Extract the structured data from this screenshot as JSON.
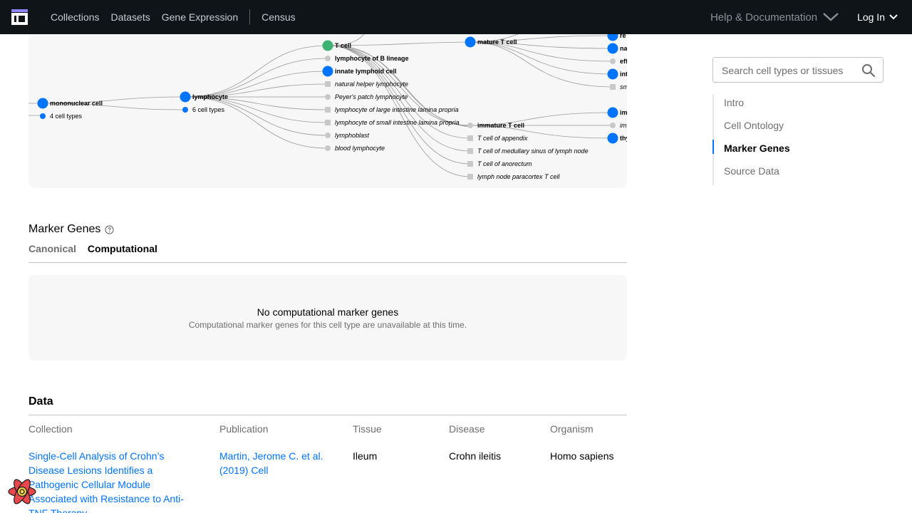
{
  "nav": {
    "links": [
      "Collections",
      "Datasets",
      "Gene Expression"
    ],
    "census": "Census",
    "help": "Help & Documentation",
    "login": "Log In"
  },
  "ontology": {
    "nodes": {
      "mononuclear": "mononuclear cell",
      "mononuclear_count": "4 cell types",
      "lymphocyte": "lymphocyte",
      "lymphocyte_count": "6 cell types",
      "t_cell": "T cell",
      "b_lineage": "lymphocyte of B lineage",
      "innate": "innate lymphoid cell",
      "natural_helper": "natural helper lymphocyte",
      "peyers": "Peyer's patch lymphocyte",
      "large_intestine": "lymphocyte of large intestine lamina propria",
      "small_intestine": "lymphocyte of small intestine lamina propria",
      "lymphoblast": "lymphoblast",
      "blood": "blood lymphocyte",
      "mature_t": "mature T cell",
      "immature_t": "immature T cell",
      "appendix": "T cell of appendix",
      "medullary": "T cell of medullary sinus of lymph node",
      "anorectum": "T cell of anorectum",
      "paracortex": "lymph node paracortex T cell",
      "r1": "re",
      "r2": "na",
      "r3": "eff",
      "r4": "int",
      "r5": "sm",
      "r6": "im",
      "r7": "im",
      "r8": "thy"
    }
  },
  "marker_genes": {
    "title": "Marker Genes",
    "tabs": [
      "Canonical",
      "Computational"
    ],
    "active_tab": "Computational",
    "empty_title": "No computational marker genes",
    "empty_sub": "Computational marker genes for this cell type are unavailable at this time."
  },
  "data_section": {
    "title": "Data",
    "columns": [
      "Collection",
      "Publication",
      "Tissue",
      "Disease",
      "Organism"
    ],
    "row": {
      "collection": "Single-Cell Analysis of Crohn’s Disease Lesions Identifies a Pathogenic Cellular Module Associated with Resistance to Anti-TNF Therapy",
      "publication": "Martin, Jerome C. et al. (2019) Cell",
      "tissue": "Ileum",
      "disease": "Crohn ileitis",
      "organism": "Homo sapiens"
    }
  },
  "sidebar": {
    "search_placeholder": "Search cell types or tissues",
    "toc": [
      "Intro",
      "Cell Ontology",
      "Marker Genes",
      "Source Data"
    ],
    "active": "Marker Genes"
  },
  "colors": {
    "nav_bg": "#0f1419",
    "accent_blue": "#0073ff",
    "node_green": "#3cb371",
    "node_grey": "#c8c8c8",
    "panel_bg": "#f7f7f7"
  }
}
